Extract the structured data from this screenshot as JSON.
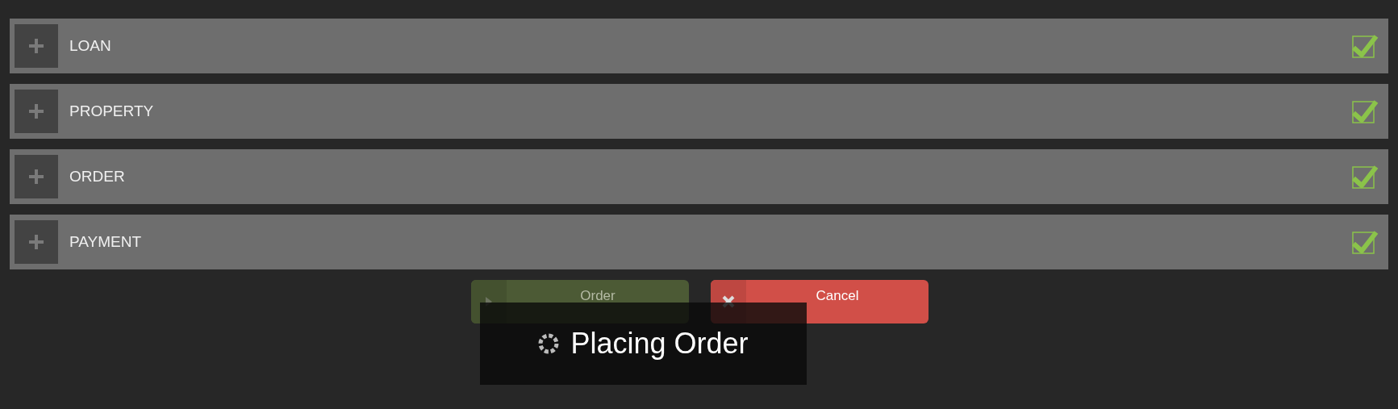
{
  "sections": [
    {
      "title": "LOAN",
      "expanded": false,
      "checked": true
    },
    {
      "title": "PROPERTY",
      "expanded": false,
      "checked": true
    },
    {
      "title": "ORDER",
      "expanded": false,
      "checked": true
    },
    {
      "title": "PAYMENT",
      "expanded": false,
      "checked": true
    }
  ],
  "buttons": [
    {
      "kind": "order",
      "label": "Order",
      "disabled": true
    },
    {
      "kind": "cancel",
      "label": "Cancel",
      "disabled": false
    }
  ],
  "overlay": {
    "message": "Placing Order"
  }
}
